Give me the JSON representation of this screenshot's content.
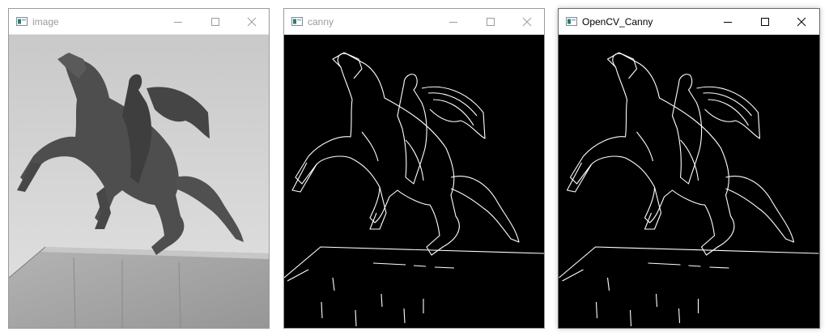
{
  "windows": [
    {
      "title": "image",
      "active": false
    },
    {
      "title": "canny",
      "active": false
    },
    {
      "title": "OpenCV_Canny",
      "active": true
    }
  ],
  "icons": {
    "app": "opencv-window-icon",
    "minimize": "minimize-icon",
    "maximize": "maximize-icon",
    "close": "close-icon"
  },
  "colors": {
    "titlebar_bg": "#ffffff",
    "inactive_glyph": "#9b9b9b",
    "active_glyph": "#000000",
    "canvas_bg": "#000000",
    "edge_color": "#ffffff"
  },
  "content": {
    "image": "grayscale photograph of an equestrian statue on a stone pedestal against an overcast sky",
    "canny": "white Canny edge map of the same statue on black background",
    "OpenCV_Canny": "white Canny edge map produced by OpenCV on black background"
  }
}
